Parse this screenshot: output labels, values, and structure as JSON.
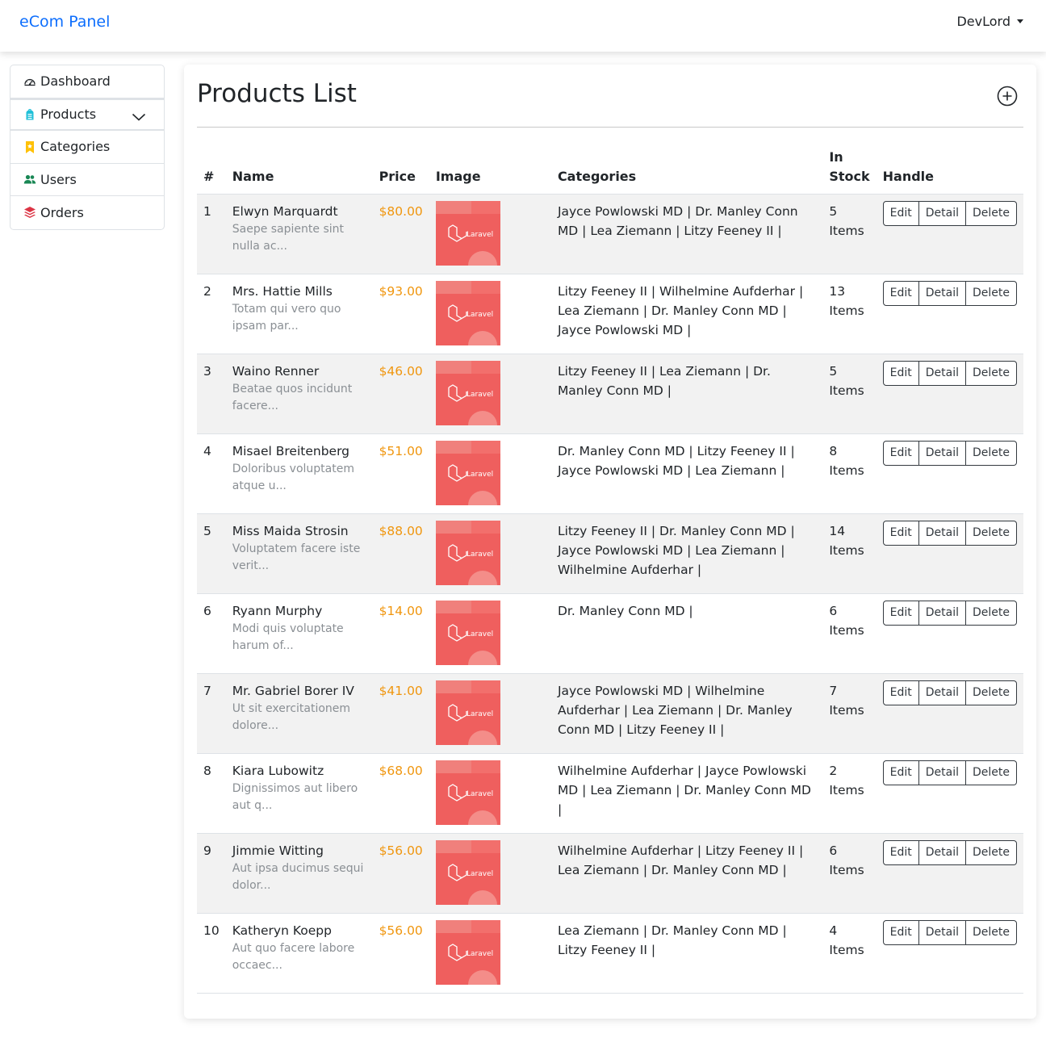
{
  "nav": {
    "brand": "eCom Panel",
    "user": "DevLord"
  },
  "sidebar": {
    "items": [
      {
        "label": "Dashboard",
        "icon": "speedometer-icon"
      },
      {
        "label": "Products",
        "icon": "tag-icon"
      },
      {
        "label": "Categories",
        "icon": "bookmark-icon"
      },
      {
        "label": "Users",
        "icon": "people-icon"
      },
      {
        "label": "Orders",
        "icon": "stack-icon"
      }
    ]
  },
  "main": {
    "title": "Products List",
    "add_icon": "plus-circle-icon",
    "columns": [
      "#",
      "Name",
      "Price",
      "Image",
      "Categories",
      "In Stock",
      "Handle"
    ],
    "buttons": {
      "edit": "Edit",
      "detail": "Detail",
      "delete": "Delete"
    },
    "image_label": "Laravel",
    "colors": {
      "price": "#f0960e",
      "thumb": "#ef5f5e",
      "brand": "#0d6efd"
    },
    "rows": [
      {
        "num": "1",
        "name": "Elwyn Marquardt",
        "desc": "Saepe sapiente sint nulla ac...",
        "price": "$80.00",
        "categories": "Jayce Powlowski MD | Dr. Manley Conn MD | Lea Ziemann | Litzy Feeney II |",
        "stock": "5 Items"
      },
      {
        "num": "2",
        "name": "Mrs. Hattie Mills",
        "desc": "Totam qui vero quo ipsam par...",
        "price": "$93.00",
        "categories": "Litzy Feeney II | Wilhelmine Aufderhar | Lea Ziemann | Dr. Manley Conn MD | Jayce Powlowski MD |",
        "stock": "13 Items"
      },
      {
        "num": "3",
        "name": "Waino Renner",
        "desc": "Beatae quos incidunt facere...",
        "price": "$46.00",
        "categories": "Litzy Feeney II | Lea Ziemann | Dr. Manley Conn MD |",
        "stock": "5 Items"
      },
      {
        "num": "4",
        "name": "Misael Breitenberg",
        "desc": "Doloribus voluptatem atque u...",
        "price": "$51.00",
        "categories": "Dr. Manley Conn MD | Litzy Feeney II | Jayce Powlowski MD | Lea Ziemann |",
        "stock": "8 Items"
      },
      {
        "num": "5",
        "name": "Miss Maida Strosin",
        "desc": "Voluptatem facere iste verit...",
        "price": "$88.00",
        "categories": "Litzy Feeney II | Dr. Manley Conn MD | Jayce Powlowski MD | Lea Ziemann | Wilhelmine Aufderhar |",
        "stock": "14 Items"
      },
      {
        "num": "6",
        "name": "Ryann Murphy",
        "desc": "Modi quis voluptate harum of...",
        "price": "$14.00",
        "categories": "Dr. Manley Conn MD |",
        "stock": "6 Items"
      },
      {
        "num": "7",
        "name": "Mr. Gabriel Borer IV",
        "desc": "Ut sit exercitationem dolore...",
        "price": "$41.00",
        "categories": "Jayce Powlowski MD | Wilhelmine Aufderhar | Lea Ziemann | Dr. Manley Conn MD | Litzy Feeney II |",
        "stock": "7 Items"
      },
      {
        "num": "8",
        "name": "Kiara Lubowitz",
        "desc": "Dignissimos aut libero aut q...",
        "price": "$68.00",
        "categories": "Wilhelmine Aufderhar | Jayce Powlowski MD | Lea Ziemann | Dr. Manley Conn MD |",
        "stock": "2 Items"
      },
      {
        "num": "9",
        "name": "Jimmie Witting",
        "desc": "Aut ipsa ducimus sequi dolor...",
        "price": "$56.00",
        "categories": "Wilhelmine Aufderhar | Litzy Feeney II | Lea Ziemann | Dr. Manley Conn MD |",
        "stock": "6 Items"
      },
      {
        "num": "10",
        "name": "Katheryn Koepp",
        "desc": "Aut quo facere labore occaec...",
        "price": "$56.00",
        "categories": "Lea Ziemann | Dr. Manley Conn MD | Litzy Feeney II |",
        "stock": "4 Items"
      }
    ]
  }
}
